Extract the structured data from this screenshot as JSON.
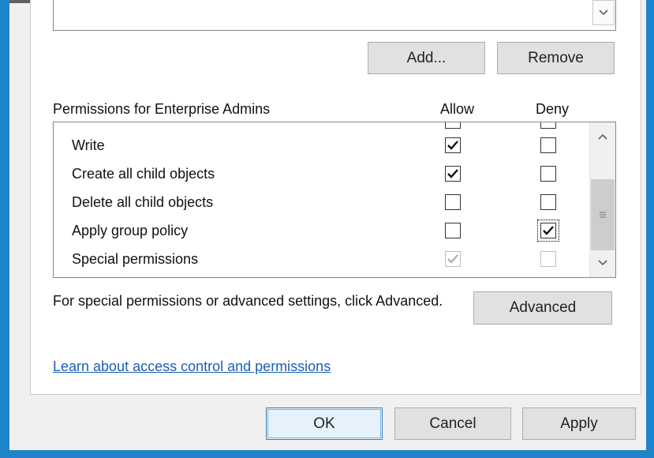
{
  "top_list": {
    "scroll_down_icon": "chevron-down-icon"
  },
  "buttons": {
    "add": "Add...",
    "remove": "Remove",
    "advanced": "Advanced",
    "ok": "OK",
    "cancel": "Cancel",
    "apply": "Apply"
  },
  "permissions": {
    "header": "Permissions for Enterprise Admins",
    "allow_header": "Allow",
    "deny_header": "Deny",
    "rows": [
      {
        "name": "Write",
        "allow": true,
        "deny": false
      },
      {
        "name": "Create all child objects",
        "allow": true,
        "deny": false
      },
      {
        "name": "Delete all child objects",
        "allow": false,
        "deny": false
      },
      {
        "name": "Apply group policy",
        "allow": false,
        "deny": true,
        "deny_focused": true
      },
      {
        "name": "Special permissions",
        "allow": true,
        "deny": false,
        "disabled": true
      }
    ]
  },
  "advanced_text": "For special permissions or advanced settings, click Advanced.",
  "learn_link": "Learn about access control and permissions",
  "colors": {
    "frame_accent": "#1f85c9",
    "link": "#1a5fb4",
    "button_face": "#e1e1e1",
    "default_button_border": "#3c7fb1"
  }
}
